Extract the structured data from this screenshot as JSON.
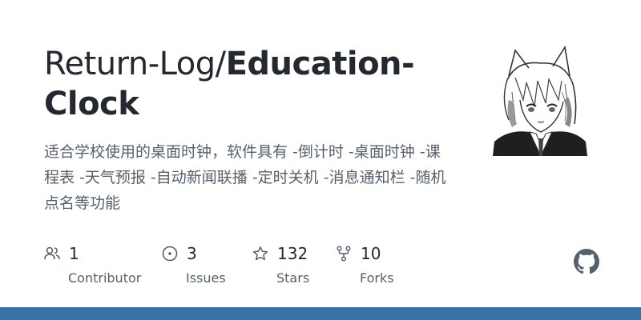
{
  "repo": {
    "owner": "Return-Log/",
    "name_line1": "Education-",
    "name_line2": "Clock",
    "description": "适合学校使用的桌面时钟，软件具有 -倒计时 -桌面时钟 -课程表 -天气预报 -自动新闻联播 -定时关机 -消息通知栏 -随机点名等功能"
  },
  "stats": {
    "contributors": {
      "count": "1",
      "label": "Contributor",
      "icon": "people-icon"
    },
    "issues": {
      "count": "3",
      "label": "Issues",
      "icon": "issue-opened-icon"
    },
    "stars": {
      "count": "132",
      "label": "Stars",
      "icon": "star-icon"
    },
    "forks": {
      "count": "10",
      "label": "Forks",
      "icon": "repo-forked-icon"
    }
  },
  "colors": {
    "language_bar": "#3572a5",
    "text_primary": "#24292f",
    "text_secondary": "#57606a"
  },
  "avatar": {
    "icon": "anime-character-avatar"
  },
  "brand": {
    "icon": "github-mark-icon"
  }
}
